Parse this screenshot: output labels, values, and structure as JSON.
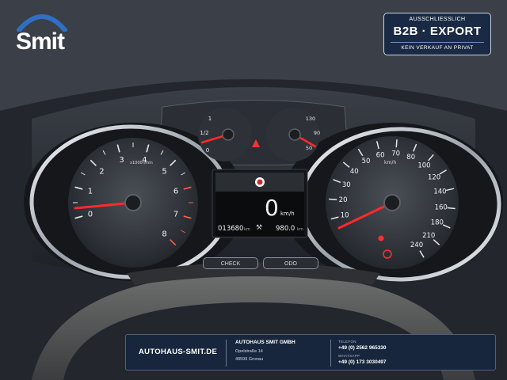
{
  "logo": {
    "text": "Smit"
  },
  "badge": {
    "top": "AUSSCHLIESSLICH",
    "main": "B2B  ·  EXPORT",
    "bottom": "KEIN VERKAUF AN PRIVAT"
  },
  "tachometer": {
    "unit": "x1000r/min",
    "ticks": [
      "0",
      "1",
      "2",
      "3",
      "4",
      "5",
      "6",
      "7",
      "8"
    ],
    "needle_value": 0.9
  },
  "speedometer": {
    "unit": "km/h",
    "ticks": [
      "10",
      "20",
      "30",
      "40",
      "50",
      "60",
      "70",
      "80",
      "100",
      "120",
      "140",
      "160",
      "180",
      "210",
      "240"
    ],
    "needle_value": 0
  },
  "fuel_gauge": {
    "ticks": [
      "0",
      "1/2",
      "1"
    ]
  },
  "temp_gauge": {
    "ticks": [
      "50",
      "90",
      "130"
    ]
  },
  "display": {
    "speed": "0",
    "speed_unit": "km/h",
    "odometer": "013680",
    "odometer_unit": "km",
    "trip": "980.0",
    "trip_unit": "km"
  },
  "buttons": {
    "check": "CHECK",
    "odo": "ODO"
  },
  "footer": {
    "website": "AUTOHAUS-SMIT.DE",
    "company": "AUTOHAUS SMIT GMBH",
    "street": "Opelstraße 14",
    "city": "48599 Gronau",
    "phone_label": "TELEFON",
    "phone": "+49 (0) 2562 965330",
    "whatsapp_label": "WHATSAPP",
    "whatsapp": "+49 (0) 173 3030497"
  },
  "colors": {
    "needle": "#ff2a2a",
    "badge_bg": "#1a2a44",
    "footer_bg": "#17263d",
    "chrome": "#d9dde2"
  }
}
